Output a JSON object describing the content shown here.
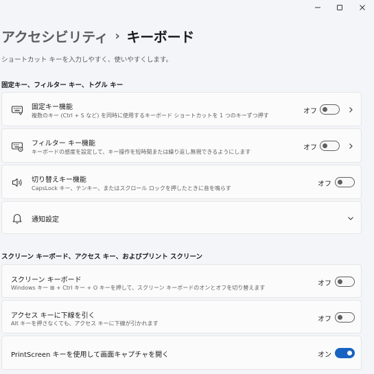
{
  "window_controls": {
    "minimize": "minimize-icon",
    "maximize": "maximize-icon",
    "close": "close-icon"
  },
  "header": {
    "parent": "アクセシビリティ",
    "separator": "›",
    "current": "キーボード"
  },
  "subtitle": "ショートカット キーを入力しやすく、使いやすくします。",
  "section1": {
    "title": "固定キー、フィルター キー、トグル キー",
    "items": [
      {
        "icon": "sticky-keys-icon",
        "title": "固定キー機能",
        "desc": "複数のキー (Ctrl + S など) を同時に使用するキーボード ショートカットを 1 つのキーずつ押す",
        "state": "オフ",
        "on": false
      },
      {
        "icon": "filter-keys-icon",
        "title": "フィルター キー機能",
        "desc": "キーボードの感度を設定して、キー操作を短時間または繰り返し無視できるようにします",
        "state": "オフ",
        "on": false
      },
      {
        "icon": "speaker-icon",
        "title": "切り替えキー機能",
        "desc": "CapsLock キー、テンキー、またはスクロール ロックを押したときに音を鳴らす",
        "state": "オフ",
        "on": false
      },
      {
        "icon": "bell-icon",
        "title": "通知設定"
      }
    ]
  },
  "section2": {
    "title": "スクリーン キーボード、アクセス キー、およびプリント スクリーン",
    "items": [
      {
        "title": "スクリーン キーボード",
        "desc": "Windows キー ⊞ + Ctrl キー + O キーを押して、スクリーン キーボードのオンとオフを切り替えます",
        "state": "オフ",
        "on": false
      },
      {
        "title": "アクセス キーに下線を引く",
        "desc": "Alt キーを押さなくても、アクセス キーに下線が引かれます",
        "state": "オフ",
        "on": false
      },
      {
        "title": "PrintScreen キーを使用して画面キャプチャを開く",
        "state": "オン",
        "on": true
      }
    ]
  },
  "colors": {
    "accent": "#1863c2",
    "background": "#f3f5f9",
    "card": "#fbfbfb"
  }
}
